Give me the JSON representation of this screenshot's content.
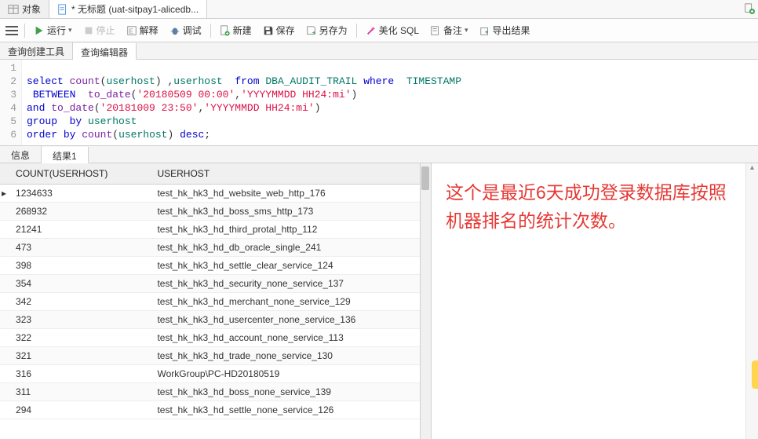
{
  "filetabs": {
    "object_label": "对象",
    "untitled_label": "* 无标题 (uat-sitpay1-alicedb..."
  },
  "toolbar": {
    "run": "运行",
    "stop": "停止",
    "explain": "解释",
    "debug": "调试",
    "new": "新建",
    "save": "保存",
    "saveas": "另存为",
    "beautify": "美化 SQL",
    "memo": "备注",
    "export": "导出结果"
  },
  "subtabs": {
    "builder": "查询创建工具",
    "editor": "查询编辑器"
  },
  "sql": {
    "lines": [
      "",
      "select count(userhost) ,userhost  from DBA_AUDIT_TRAIL where  TIMESTAMP",
      " BETWEEN  to_date('20180509 00:00','YYYYMMDD HH24:mi')",
      "and to_date('20181009 23:50','YYYYMMDD HH24:mi')",
      "group  by userhost",
      "order by count(userhost) desc;"
    ]
  },
  "restabs": {
    "info": "信息",
    "result1": "结果1"
  },
  "grid": {
    "col_count": "COUNT(USERHOST)",
    "col_userhost": "USERHOST",
    "rows": [
      {
        "count": "1234633",
        "host": "test_hk_hk3_hd_website_web_http_176"
      },
      {
        "count": "268932",
        "host": "test_hk_hk3_hd_boss_sms_http_173"
      },
      {
        "count": "21241",
        "host": "test_hk_hk3_hd_third_protal_http_112"
      },
      {
        "count": "473",
        "host": "test_hk_hk3_hd_db_oracle_single_241"
      },
      {
        "count": "398",
        "host": "test_hk_hk3_hd_settle_clear_service_124"
      },
      {
        "count": "354",
        "host": "test_hk_hk3_hd_security_none_service_137"
      },
      {
        "count": "342",
        "host": "test_hk_hk3_hd_merchant_none_service_129"
      },
      {
        "count": "323",
        "host": "test_hk_hk3_hd_usercenter_none_service_136"
      },
      {
        "count": "322",
        "host": "test_hk_hk3_hd_account_none_service_113"
      },
      {
        "count": "321",
        "host": "test_hk_hk3_hd_trade_none_service_130"
      },
      {
        "count": "316",
        "host": "WorkGroup\\PC-HD20180519"
      },
      {
        "count": "311",
        "host": "test_hk_hk3_hd_boss_none_service_139"
      },
      {
        "count": "294",
        "host": "test_hk_hk3_hd_settle_none_service_126"
      }
    ]
  },
  "annotation": "这个是最近6天成功登录数据库按照机器排名的统计次数。"
}
